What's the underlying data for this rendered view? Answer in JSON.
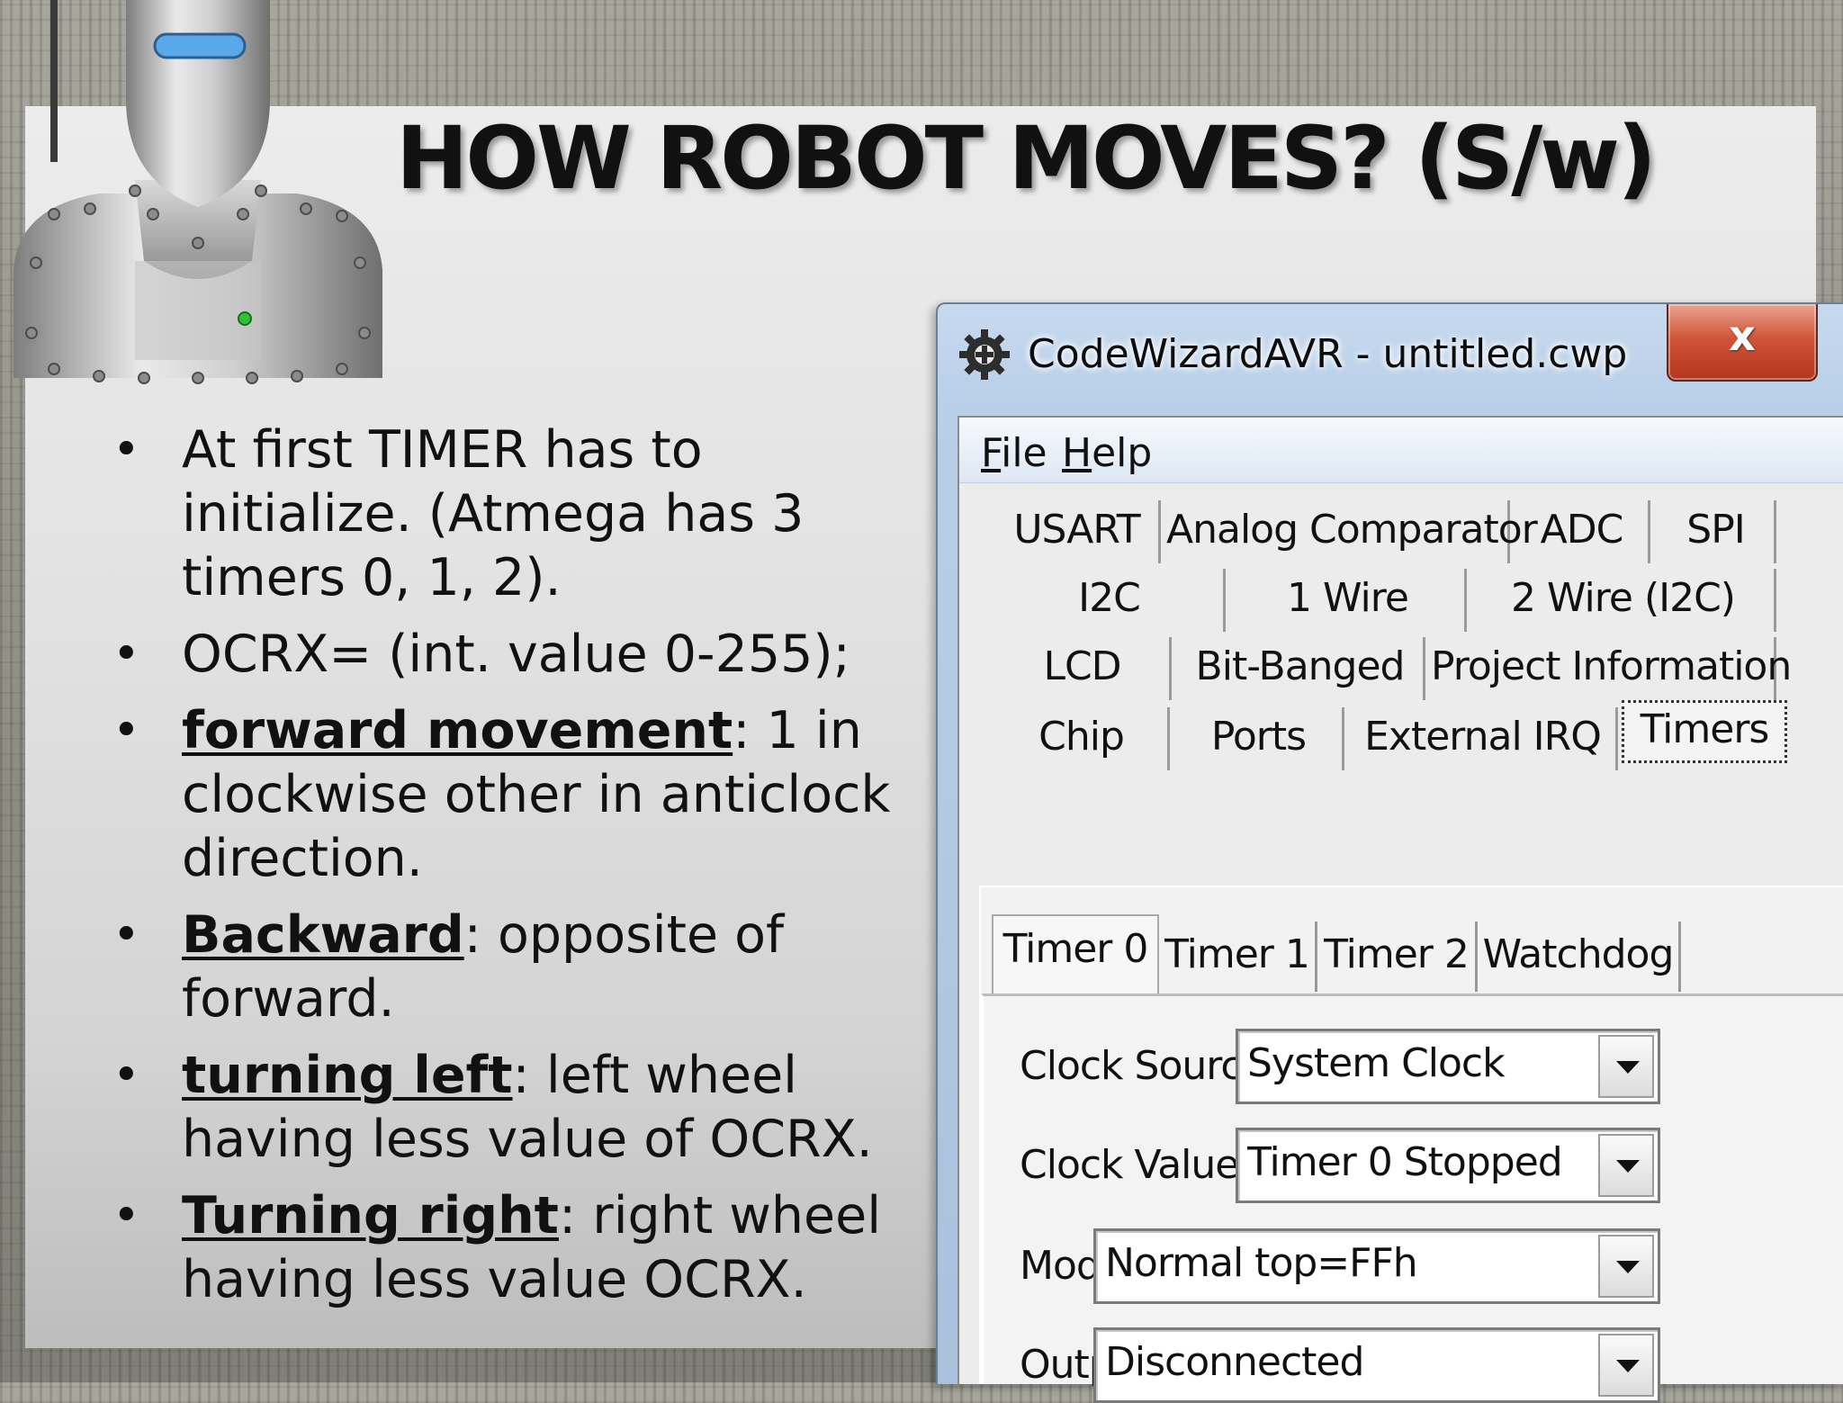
{
  "slide": {
    "title": "HOW ROBOT MOVES? (S/w)",
    "bullets": [
      {
        "parts": [
          {
            "text": "At first TIMER has to initialize. (Atmega has 3 timers 0, 1, 2).",
            "bold": false
          }
        ]
      },
      {
        "parts": [
          {
            "text": "OCRX= (int. value 0-255);",
            "bold": false
          }
        ]
      },
      {
        "parts": [
          {
            "text": "forward movement",
            "bold": true
          },
          {
            "text": ": 1 in clockwise other in anticlock direction.",
            "bold": false
          }
        ]
      },
      {
        "parts": [
          {
            "text": "Backward",
            "bold": true
          },
          {
            "text": ": opposite of forward.",
            "bold": false
          }
        ]
      },
      {
        "parts": [
          {
            "text": " ",
            "bold": false
          },
          {
            "text": "turning left",
            "bold": true
          },
          {
            "text": ": left wheel having less value of OCRX.",
            "bold": false
          }
        ]
      },
      {
        "parts": [
          {
            "text": "Turning right",
            "bold": true
          },
          {
            "text": ": right wheel having less value OCRX.",
            "bold": false
          }
        ]
      }
    ]
  },
  "window": {
    "title": "CodeWizardAVR - untitled.cwp",
    "close_label": "x",
    "menu": [
      {
        "mnemonic": "F",
        "rest": "ile"
      },
      {
        "mnemonic": "H",
        "rest": "elp"
      }
    ],
    "tab_rows": [
      [
        "USART",
        "Analog Comparator",
        "ADC",
        "SPI"
      ],
      [
        "I2C",
        "1 Wire",
        "2 Wire (I2C)"
      ],
      [
        "LCD",
        "Bit-Banged",
        "Project Information"
      ],
      [
        "Chip",
        "Ports",
        "External IRQ",
        "Timers"
      ]
    ],
    "selected_tab": "Timers",
    "subtabs": [
      "Timer 0",
      "Timer 1",
      "Timer 2",
      "Watchdog"
    ],
    "selected_subtab": "Timer 0",
    "fields": [
      {
        "label": "Clock Source:",
        "value": "System Clock"
      },
      {
        "label": "Clock Value:",
        "value": "Timer 0 Stopped"
      },
      {
        "label": "Mode:",
        "value": "Normal top=FFh"
      },
      {
        "label": "Output:",
        "value": "Disconnected"
      }
    ]
  },
  "colors": {
    "close_red": "#c9452a",
    "title_bar": "#bcd2ea",
    "panel": "#e6e6e6"
  }
}
